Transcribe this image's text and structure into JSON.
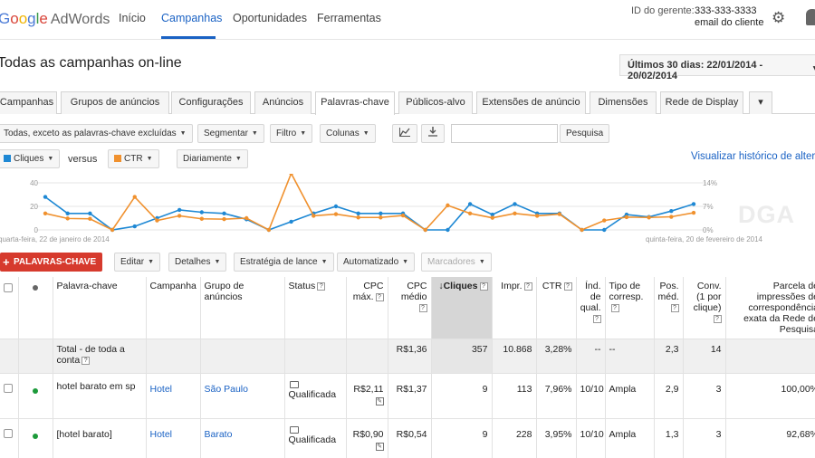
{
  "header": {
    "logo_google": "Google",
    "logo_product": "AdWords",
    "nav": [
      "Início",
      "Campanhas",
      "Oportunidades",
      "Ferramentas"
    ],
    "manager_label": "ID do gerente:",
    "manager_id": "333-333-3333",
    "manager_email": "email do cliente"
  },
  "page": {
    "title": "Todas as campanhas on-line",
    "date_range": "Últimos 30 dias: 22/01/2014 - 20/02/2014"
  },
  "tabs": [
    "Campanhas",
    "Grupos de anúncios",
    "Configurações",
    "Anúncios",
    "Palavras-chave",
    "Públicos-alvo",
    "Extensões de anúncio",
    "Dimensões",
    "Rede de Display"
  ],
  "toolbar": {
    "filter_all": "Todas, exceto as palavras-chave excluídas",
    "segment": "Segmentar",
    "filter": "Filtro",
    "columns": "Colunas",
    "search_button": "Pesquisa"
  },
  "chart_controls": {
    "metric1": "Cliques",
    "versus": "versus",
    "metric2": "CTR",
    "period": "Diariamente",
    "history_link": "Visualizar histórico de alterações"
  },
  "chart_data": {
    "type": "line",
    "y_left_ticks": [
      "40",
      "20",
      "0"
    ],
    "y_right_ticks": [
      "14%",
      "7%",
      "0%"
    ],
    "x_start_label": "quarta-feira, 22 de janeiro de 2014",
    "x_end_label": "quinta-feira, 20 de fevereiro de 2014",
    "ylim_left": [
      0,
      40
    ],
    "ylim_right": [
      0,
      14
    ],
    "grid": true,
    "series": [
      {
        "name": "Cliques",
        "axis": "left",
        "color": "#1e88d4",
        "values": [
          28,
          14,
          14,
          0,
          3,
          10,
          17,
          15,
          14,
          9,
          0,
          7,
          14,
          20,
          14,
          14,
          14,
          0,
          0,
          22,
          13,
          22,
          14,
          14,
          0,
          0,
          13,
          11,
          16,
          22
        ]
      },
      {
        "name": "CTR",
        "axis": "right",
        "color": "#f0912e",
        "values": [
          4.9,
          3.4,
          3.3,
          0,
          9.8,
          2.8,
          4.2,
          3.3,
          3.2,
          3.5,
          0,
          16.8,
          4.2,
          4.7,
          3.7,
          3.7,
          4.3,
          0,
          7.3,
          4.9,
          3.6,
          4.9,
          4.2,
          4.7,
          0,
          2.8,
          3.8,
          3.7,
          3.9,
          5.1
        ]
      }
    ]
  },
  "actions": {
    "add_keywords": "PALAVRAS-CHAVE",
    "edit": "Editar",
    "details": "Detalhes",
    "bid_strategy": "Estratégia de lance",
    "automated": "Automatizado",
    "labels": "Marcadores"
  },
  "table": {
    "headers": {
      "keyword": "Palavra-chave",
      "campaign": "Campanha",
      "ad_group": "Grupo de anúncios",
      "status": "Status",
      "max_cpc": "CPC máx.",
      "avg_cpc": "CPC médio",
      "clicks": "Cliques",
      "impr": "Impr.",
      "ctr": "CTR",
      "quality": "Índ. de qual.",
      "match_type": "Tipo de corresp.",
      "avg_pos": "Pos. méd.",
      "conv": "Conv. (1 por clique)",
      "impr_share": "Parcela de impressões de correspondência exata da Rede de Pesquisa"
    },
    "total": {
      "label": "Total - de toda a conta",
      "avg_cpc": "R$1,36",
      "clicks": "357",
      "impr": "10.868",
      "ctr": "3,28%",
      "quality": "--",
      "match_type": "--",
      "avg_pos": "2,3",
      "conv": "14"
    },
    "rows": [
      {
        "keyword": "hotel barato em sp",
        "campaign": "Hotel",
        "ad_group": "São Paulo",
        "status": "Qualificada",
        "max_cpc": "R$2,11",
        "avg_cpc": "R$1,37",
        "clicks": "9",
        "impr": "113",
        "ctr": "7,96%",
        "quality": "10/10",
        "match_type": "Ampla",
        "avg_pos": "2,9",
        "conv": "3",
        "impr_share": "100,00%"
      },
      {
        "keyword": "[hotel barato]",
        "campaign": "Hotel",
        "ad_group": "Barato",
        "status": "Qualificada",
        "max_cpc": "R$0,90",
        "avg_cpc": "R$0,54",
        "clicks": "9",
        "impr": "228",
        "ctr": "3,95%",
        "quality": "10/10",
        "match_type": "Ampla",
        "avg_pos": "1,3",
        "conv": "3",
        "impr_share": "92,68%"
      }
    ]
  },
  "watermark": "DGA",
  "colors": {
    "accent": "#1a62c4",
    "add_button": "#d63a2d",
    "clicks": "#1e88d4",
    "ctr": "#f0912e"
  }
}
